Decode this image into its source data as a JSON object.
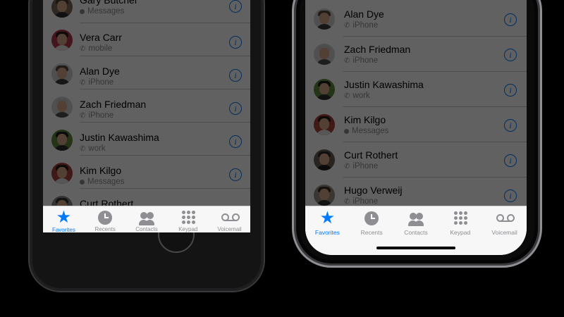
{
  "left_phone": {
    "contacts": [
      {
        "name": "Gary Butcher",
        "sub": "Messages",
        "sub_type": "message",
        "info": "i"
      },
      {
        "name": "Vera Carr",
        "sub": "mobile",
        "sub_type": "phone",
        "info": "i"
      },
      {
        "name": "Alan Dye",
        "sub": "iPhone",
        "sub_type": "phone",
        "info": "i"
      },
      {
        "name": "Zach Friedman",
        "sub": "iPhone",
        "sub_type": "phone",
        "info": "i"
      },
      {
        "name": "Justin Kawashima",
        "sub": "work",
        "sub_type": "phone",
        "info": "i"
      },
      {
        "name": "Kim Kilgo",
        "sub": "Messages",
        "sub_type": "message",
        "info": "i"
      },
      {
        "name": "Curt Rothert",
        "sub": "",
        "sub_type": "phone",
        "info": ""
      }
    ]
  },
  "right_phone": {
    "contacts": [
      {
        "name": "Alan Dye",
        "sub": "iPhone",
        "sub_type": "phone",
        "info": "i"
      },
      {
        "name": "Zach Friedman",
        "sub": "iPhone",
        "sub_type": "phone",
        "info": "i"
      },
      {
        "name": "Justin Kawashima",
        "sub": "work",
        "sub_type": "phone",
        "info": "i"
      },
      {
        "name": "Kim Kilgo",
        "sub": "Messages",
        "sub_type": "message",
        "info": "i"
      },
      {
        "name": "Curt Rothert",
        "sub": "iPhone",
        "sub_type": "phone",
        "info": "i"
      },
      {
        "name": "Hugo Verweij",
        "sub": "iPhone",
        "sub_type": "phone",
        "info": "i"
      }
    ]
  },
  "tabs": [
    {
      "label": "Favorites",
      "icon": "star-icon",
      "active": true
    },
    {
      "label": "Recents",
      "icon": "clock-icon",
      "active": false
    },
    {
      "label": "Contacts",
      "icon": "contacts-icon",
      "active": false
    },
    {
      "label": "Keypad",
      "icon": "keypad-icon",
      "active": false
    },
    {
      "label": "Voicemail",
      "icon": "voicemail-icon",
      "active": false
    }
  ],
  "colors": {
    "accent": "#007aff",
    "secondary_text": "#8e8e93",
    "tabbar_bg": "#f7f7f7",
    "background": "#000000"
  }
}
